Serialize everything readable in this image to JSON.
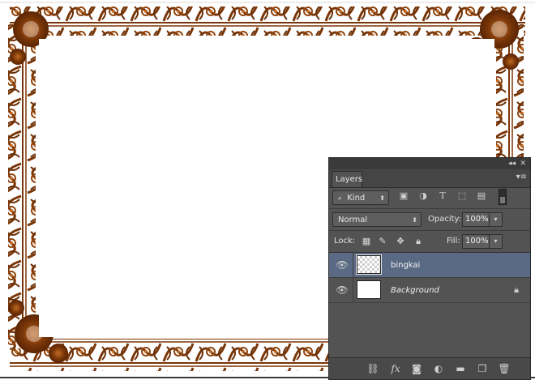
{
  "colors": {
    "frame": "#7a3608",
    "frame_light": "#c06a24",
    "panel": "#535353",
    "selected_layer": "#5a6a84"
  },
  "panel": {
    "collapse_icon": "double-chevron-left-icon",
    "close_icon": "close-icon",
    "tab_label": "Layers",
    "menu_icon": "panel-menu-icon",
    "filter": {
      "kind_label": "Kind",
      "icons": [
        "image-filter-icon",
        "adjustment-filter-icon",
        "type-filter-icon",
        "shape-filter-icon",
        "smart-object-filter-icon"
      ]
    },
    "blend_mode": "Normal",
    "opacity_label": "Opacity:",
    "opacity_value": "100%",
    "lock_label": "Lock:",
    "fill_label": "Fill:",
    "fill_value": "100%",
    "layers": [
      {
        "name": "bingkai",
        "selected": true,
        "italic": false,
        "thumbnail": "transparent",
        "locked": false
      },
      {
        "name": "Background",
        "selected": false,
        "italic": true,
        "thumbnail": "white",
        "locked": true
      }
    ],
    "bottom_icons": [
      "link-layers-icon",
      "fx-icon",
      "add-mask-icon",
      "adjustment-layer-icon",
      "new-group-icon",
      "new-layer-icon",
      "delete-icon"
    ]
  }
}
